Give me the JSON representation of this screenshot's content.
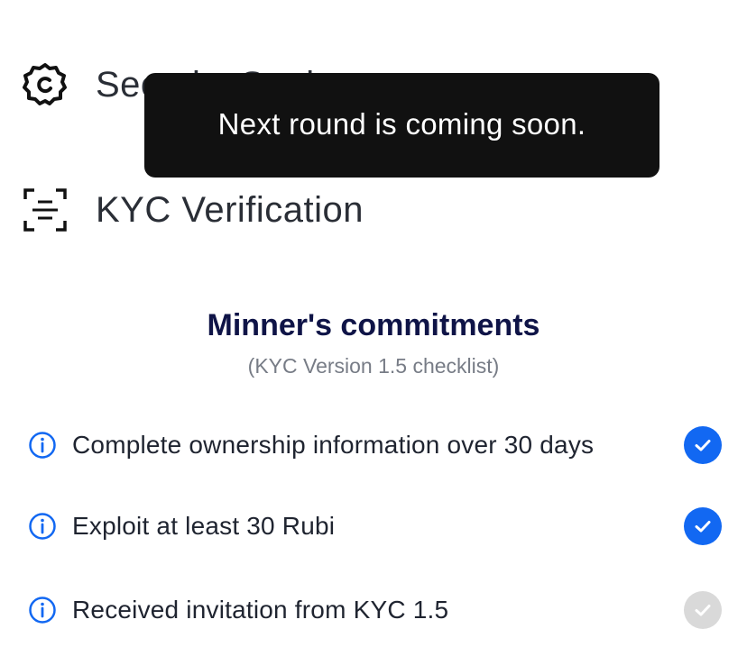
{
  "menu": {
    "security_setting_label": "Security Setting",
    "kyc_verification_label": "KYC Verification"
  },
  "toast": {
    "message": "Next round is coming soon."
  },
  "commitments": {
    "title": "Minner's commitments",
    "subtitle": "(KYC Version 1.5 checklist)",
    "items": [
      {
        "label": "Complete ownership information over 30 days",
        "status": "done"
      },
      {
        "label": "Exploit at least 30 Rubi",
        "status": "done"
      },
      {
        "label": "Received invitation from KYC 1.5",
        "status": "pending"
      }
    ]
  },
  "colors": {
    "accent_blue": "#1268f2",
    "title_navy": "#0f1447",
    "pending_gray": "#d9d9d9",
    "toast_bg": "#111111"
  },
  "icons": {
    "security": "gear-icon",
    "kyc": "scan-icon",
    "info": "info-circle-icon",
    "check": "check-circle-icon"
  }
}
